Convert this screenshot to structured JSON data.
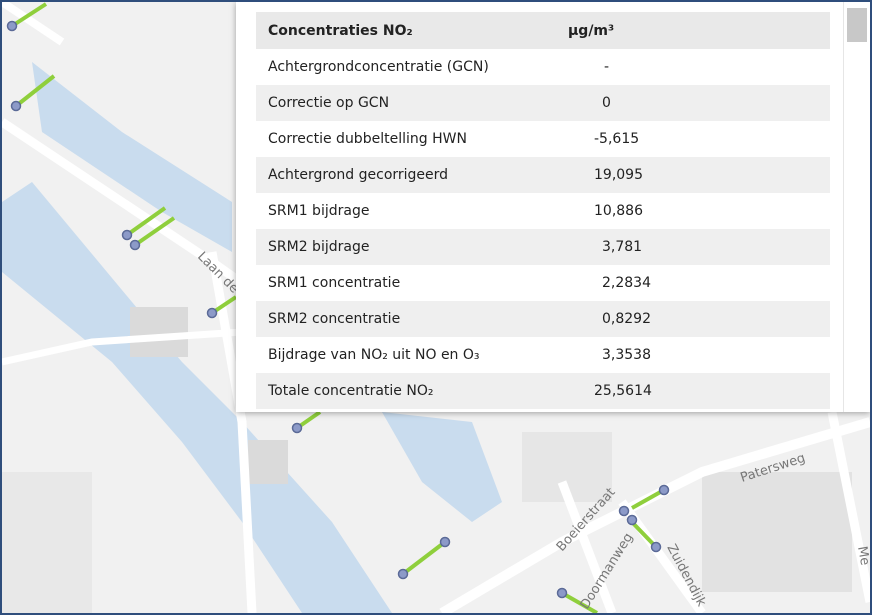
{
  "map": {
    "street_labels": [
      "Laan de",
      "Patersweg",
      "Boeierstraat",
      "Doormanweg",
      "Zuidendijk",
      "Me"
    ],
    "colors": {
      "road": "#ffffff",
      "water": "#c9dcee",
      "building": "#dadada",
      "segment": "#8fcf3c",
      "node": "#8c9ac8"
    }
  },
  "table": {
    "header": {
      "label": "Concentraties NO₂",
      "unit": "µg/m³"
    },
    "rows": [
      {
        "label": "Achtergrondconcentratie (GCN)",
        "value": "-"
      },
      {
        "label": "Correctie op GCN",
        "value": "0"
      },
      {
        "label": "Correctie dubbeltelling HWN",
        "value": "-5,615"
      },
      {
        "label": "Achtergrond gecorrigeerd",
        "value": "19,095"
      },
      {
        "label": "SRM1 bijdrage",
        "value": "10,886"
      },
      {
        "label": "SRM2 bijdrage",
        "value": "3,781"
      },
      {
        "label": "SRM1 concentratie",
        "value": "2,2834"
      },
      {
        "label": "SRM2 concentratie",
        "value": "0,8292"
      },
      {
        "label": "Bijdrage van NO₂ uit NO en O₃",
        "value": "3,3538"
      },
      {
        "label": "Totale concentratie NO₂",
        "value": "25,5614"
      }
    ]
  }
}
